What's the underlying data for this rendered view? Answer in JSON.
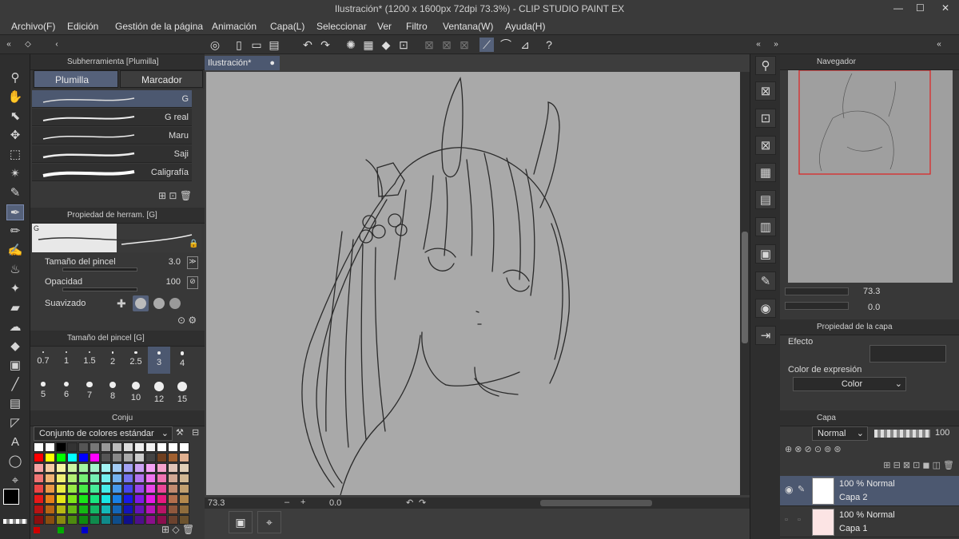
{
  "window": {
    "title": "Ilustración* (1200 x 1600px 72dpi 73.3%) - CLIP STUDIO PAINT EX",
    "min": "—",
    "max": "☐",
    "close": "✕"
  },
  "menu": [
    "Archivo(F)",
    "Edición",
    "Gestión de la página",
    "Animación",
    "Capa(L)",
    "Seleccionar",
    "Ver",
    "Filtro",
    "Ventana(W)",
    "Ayuda(H)"
  ],
  "subtool": {
    "title": "Subherramienta [Plumilla]",
    "tabs": [
      "Plumilla",
      "Marcador"
    ],
    "brushes": [
      "G",
      "G real",
      "Maru",
      "Saji",
      "Caligrafía"
    ]
  },
  "toolprop": {
    "title": "Propiedad de herram. [G]",
    "preview_label": "G",
    "size_label": "Tamaño del pincel",
    "size_value": "3.0",
    "opacity_label": "Opacidad",
    "opacity_value": "100",
    "smoothing_label": "Suavizado"
  },
  "brushsize": {
    "title": "Tamaño del pincel [G]",
    "sizes": [
      "0.7",
      "1",
      "1.5",
      "2",
      "2.5",
      "3",
      "4",
      "5",
      "6",
      "7",
      "8",
      "10",
      "12",
      "15"
    ],
    "selected": "3"
  },
  "colorset": {
    "tab": "Conju",
    "name": "Conjunto de colores estándar"
  },
  "document": {
    "tab": "Ilustración*",
    "zoom": "73.3",
    "rotation": "0.0"
  },
  "navigator": {
    "title": "Navegador",
    "zoom": "73.3",
    "rotation": "0.0"
  },
  "layerprop": {
    "title": "Propiedad de la capa",
    "effect_label": "Efecto",
    "expr_label": "Color de expresión",
    "expr_value": "Color"
  },
  "layers": {
    "title": "Capa",
    "blend_mode": "Normal",
    "opacity": "100",
    "items": [
      {
        "line1": "100 % Normal",
        "line2": "Capa 2",
        "selected": true
      },
      {
        "line1": "100 % Normal",
        "line2": "Capa 1",
        "selected": false
      }
    ]
  }
}
